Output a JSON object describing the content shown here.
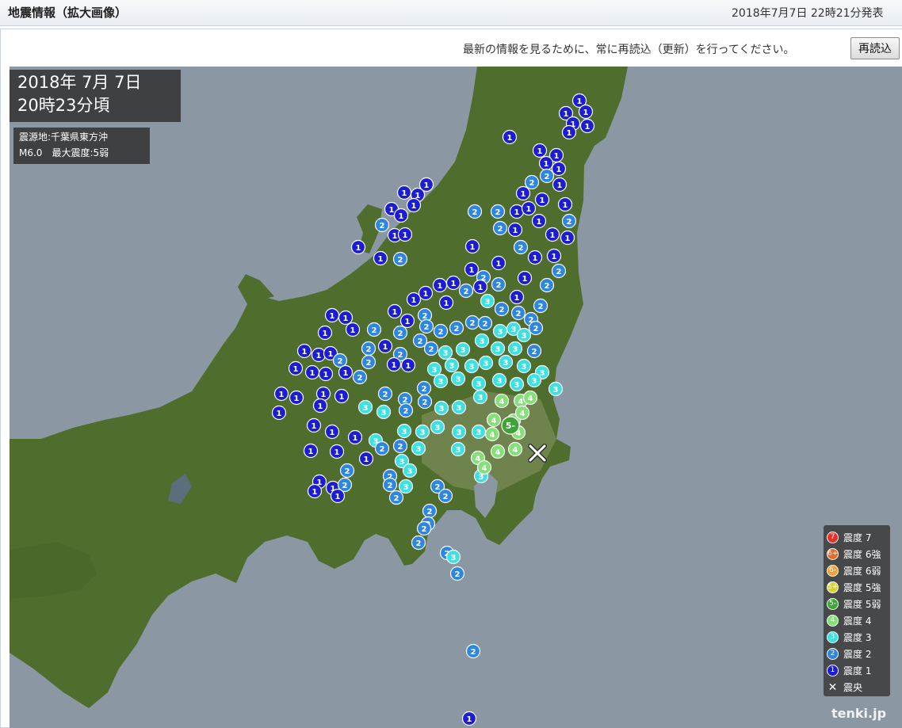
{
  "header": {
    "title": "地震情報（拡大画像）",
    "issued": "2018年7月7日 22時21分発表"
  },
  "reload": {
    "message": "最新の情報を見るために、常に再読込（更新）を行ってください。",
    "button": "再読込"
  },
  "quake": {
    "date": "2018年 7月 7日",
    "time": "20時23分頃",
    "epicenter_line": "震源地:千葉県東方沖",
    "mag_line": "M6.0　最大震度:5弱"
  },
  "legend": [
    {
      "label": "震度 7",
      "badge": "7",
      "color": "#e8302a"
    },
    {
      "label": "震度 6強",
      "badge": "6+",
      "color": "#e86a28"
    },
    {
      "label": "震度 6弱",
      "badge": "6-",
      "color": "#eba23a"
    },
    {
      "label": "震度 5強",
      "badge": "5+",
      "color": "#d6d42e"
    },
    {
      "label": "震度 5弱",
      "badge": "5-",
      "color": "#3fa33a"
    },
    {
      "label": "震度 4",
      "badge": "4",
      "color": "#86e07a"
    },
    {
      "label": "震度 3",
      "badge": "3",
      "color": "#3fe0e0"
    },
    {
      "label": "震度 2",
      "badge": "2",
      "color": "#2f86e0"
    },
    {
      "label": "震度 1",
      "badge": "1",
      "color": "#1c1cd2"
    }
  ],
  "legend_epicenter": "震央",
  "credit": "tenki.jp",
  "colors": {
    "ocean": "#8b98a3",
    "land": "#4e6b2c",
    "i1": "#1c1cd2",
    "i2": "#2f86e0",
    "i3": "#3fe0e0",
    "i4": "#86e07a",
    "i5m": "#3fa33a"
  },
  "markers": [
    [
      731,
      127,
      "1"
    ],
    [
      714,
      143,
      "1"
    ],
    [
      739,
      141,
      "1"
    ],
    [
      723,
      156,
      "1"
    ],
    [
      741,
      159,
      "1"
    ],
    [
      718,
      167,
      "1"
    ],
    [
      643,
      173,
      "1"
    ],
    [
      681,
      190,
      "1"
    ],
    [
      702,
      196,
      "1"
    ],
    [
      689,
      206,
      "1"
    ],
    [
      705,
      213,
      "1"
    ],
    [
      690,
      222,
      "2"
    ],
    [
      706,
      233,
      "1"
    ],
    [
      671,
      230,
      "2"
    ],
    [
      660,
      244,
      "1"
    ],
    [
      538,
      233,
      "1"
    ],
    [
      510,
      243,
      "1"
    ],
    [
      527,
      246,
      "1"
    ],
    [
      522,
      259,
      "1"
    ],
    [
      494,
      264,
      "1"
    ],
    [
      506,
      272,
      "1"
    ],
    [
      599,
      267,
      "2"
    ],
    [
      628,
      267,
      "2"
    ],
    [
      652,
      267,
      "1"
    ],
    [
      667,
      263,
      "1"
    ],
    [
      684,
      252,
      "1"
    ],
    [
      713,
      258,
      "1"
    ],
    [
      718,
      279,
      "2"
    ],
    [
      482,
      284,
      "2"
    ],
    [
      498,
      297,
      "1"
    ],
    [
      511,
      296,
      "1"
    ],
    [
      452,
      312,
      "1"
    ],
    [
      480,
      326,
      "1"
    ],
    [
      505,
      327,
      "2"
    ],
    [
      596,
      311,
      "1"
    ],
    [
      631,
      288,
      "2"
    ],
    [
      650,
      290,
      "1"
    ],
    [
      680,
      279,
      "1"
    ],
    [
      697,
      296,
      "1"
    ],
    [
      716,
      300,
      "1"
    ],
    [
      657,
      312,
      "2"
    ],
    [
      675,
      325,
      "1"
    ],
    [
      699,
      323,
      "1"
    ],
    [
      705,
      342,
      "2"
    ],
    [
      629,
      332,
      "1"
    ],
    [
      610,
      350,
      "2"
    ],
    [
      595,
      340,
      "1"
    ],
    [
      572,
      357,
      "1"
    ],
    [
      555,
      360,
      "1"
    ],
    [
      537,
      370,
      "1"
    ],
    [
      522,
      378,
      "1"
    ],
    [
      588,
      367,
      "2"
    ],
    [
      606,
      362,
      "1"
    ],
    [
      629,
      359,
      "2"
    ],
    [
      662,
      351,
      "1"
    ],
    [
      690,
      360,
      "2"
    ],
    [
      652,
      375,
      "1"
    ],
    [
      682,
      386,
      "2"
    ],
    [
      498,
      393,
      "1"
    ],
    [
      514,
      405,
      "1"
    ],
    [
      536,
      398,
      "2"
    ],
    [
      563,
      382,
      "1"
    ],
    [
      615,
      380,
      "3"
    ],
    [
      633,
      390,
      "2"
    ],
    [
      654,
      395,
      "2"
    ],
    [
      670,
      403,
      "2"
    ],
    [
      419,
      398,
      "1"
    ],
    [
      436,
      401,
      "1"
    ],
    [
      410,
      420,
      "1"
    ],
    [
      445,
      416,
      "1"
    ],
    [
      472,
      416,
      "2"
    ],
    [
      505,
      420,
      "2"
    ],
    [
      538,
      412,
      "2"
    ],
    [
      556,
      418,
      "2"
    ],
    [
      576,
      414,
      "2"
    ],
    [
      596,
      407,
      "2"
    ],
    [
      612,
      408,
      "2"
    ],
    [
      631,
      418,
      "3"
    ],
    [
      648,
      415,
      "3"
    ],
    [
      661,
      423,
      "3"
    ],
    [
      676,
      414,
      "2"
    ],
    [
      384,
      443,
      "1"
    ],
    [
      402,
      448,
      "1"
    ],
    [
      417,
      446,
      "1"
    ],
    [
      429,
      455,
      "2"
    ],
    [
      465,
      440,
      "2"
    ],
    [
      486,
      437,
      "1"
    ],
    [
      505,
      447,
      "2"
    ],
    [
      530,
      430,
      "2"
    ],
    [
      544,
      440,
      "2"
    ],
    [
      562,
      445,
      "3"
    ],
    [
      584,
      441,
      "3"
    ],
    [
      608,
      430,
      "3"
    ],
    [
      628,
      440,
      "3"
    ],
    [
      650,
      440,
      "3"
    ],
    [
      674,
      443,
      "2"
    ],
    [
      373,
      465,
      "1"
    ],
    [
      394,
      470,
      "1"
    ],
    [
      411,
      472,
      "1"
    ],
    [
      436,
      470,
      "1"
    ],
    [
      465,
      457,
      "2"
    ],
    [
      497,
      460,
      "1"
    ],
    [
      515,
      461,
      "1"
    ],
    [
      548,
      466,
      "3"
    ],
    [
      570,
      461,
      "3"
    ],
    [
      595,
      462,
      "3"
    ],
    [
      613,
      458,
      "3"
    ],
    [
      638,
      457,
      "3"
    ],
    [
      661,
      462,
      "3"
    ],
    [
      684,
      470,
      "3"
    ],
    [
      355,
      497,
      "1"
    ],
    [
      374,
      502,
      "1"
    ],
    [
      408,
      497,
      "1"
    ],
    [
      454,
      476,
      "2"
    ],
    [
      486,
      497,
      "2"
    ],
    [
      511,
      504,
      "2"
    ],
    [
      535,
      490,
      "2"
    ],
    [
      556,
      481,
      "3"
    ],
    [
      578,
      478,
      "3"
    ],
    [
      604,
      484,
      "3"
    ],
    [
      630,
      480,
      "3"
    ],
    [
      652,
      485,
      "3"
    ],
    [
      674,
      480,
      "3"
    ],
    [
      701,
      491,
      "3"
    ],
    [
      352,
      521,
      "1"
    ],
    [
      404,
      512,
      "1"
    ],
    [
      431,
      500,
      "1"
    ],
    [
      461,
      514,
      "3"
    ],
    [
      484,
      520,
      "3"
    ],
    [
      512,
      518,
      "2"
    ],
    [
      536,
      507,
      "2"
    ],
    [
      557,
      515,
      "3"
    ],
    [
      579,
      514,
      "3"
    ],
    [
      606,
      501,
      "3"
    ],
    [
      633,
      506,
      "4"
    ],
    [
      657,
      506,
      "4"
    ],
    [
      669,
      502,
      "4"
    ],
    [
      396,
      537,
      "1"
    ],
    [
      419,
      545,
      "1"
    ],
    [
      448,
      552,
      "1"
    ],
    [
      474,
      556,
      "3"
    ],
    [
      510,
      544,
      "3"
    ],
    [
      533,
      545,
      "3"
    ],
    [
      552,
      539,
      "3"
    ],
    [
      579,
      545,
      "3"
    ],
    [
      604,
      545,
      "3"
    ],
    [
      623,
      530,
      "4"
    ],
    [
      648,
      531,
      "4"
    ],
    [
      659,
      521,
      "4"
    ],
    [
      621,
      548,
      "4"
    ],
    [
      654,
      546,
      "4"
    ],
    [
      392,
      569,
      "1"
    ],
    [
      425,
      570,
      "1"
    ],
    [
      462,
      579,
      "1"
    ],
    [
      482,
      566,
      "2"
    ],
    [
      505,
      563,
      "2"
    ],
    [
      528,
      566,
      "3"
    ],
    [
      578,
      567,
      "3"
    ],
    [
      603,
      578,
      "4"
    ],
    [
      628,
      570,
      "4"
    ],
    [
      650,
      567,
      "4"
    ],
    [
      607,
      601,
      "3"
    ],
    [
      611,
      590,
      "4"
    ],
    [
      438,
      594,
      "2"
    ],
    [
      507,
      582,
      "3"
    ],
    [
      517,
      594,
      "3"
    ],
    [
      492,
      601,
      "2"
    ],
    [
      403,
      608,
      "1"
    ],
    [
      420,
      616,
      "1"
    ],
    [
      435,
      612,
      "2"
    ],
    [
      397,
      620,
      "1"
    ],
    [
      426,
      626,
      "1"
    ],
    [
      492,
      612,
      "2"
    ],
    [
      512,
      614,
      "3"
    ],
    [
      500,
      628,
      "2"
    ],
    [
      552,
      614,
      "2"
    ],
    [
      562,
      626,
      "2"
    ],
    [
      542,
      645,
      "2"
    ],
    [
      540,
      661,
      "2"
    ],
    [
      535,
      667,
      "2"
    ],
    [
      528,
      685,
      "2"
    ],
    [
      564,
      698,
      "2"
    ],
    [
      572,
      703,
      "3"
    ],
    [
      577,
      724,
      "2"
    ],
    [
      597,
      822,
      "2"
    ],
    [
      592,
      907,
      "1"
    ]
  ],
  "big_marker": [
    644,
    537,
    "5-"
  ],
  "epicenter": [
    678,
    572
  ]
}
